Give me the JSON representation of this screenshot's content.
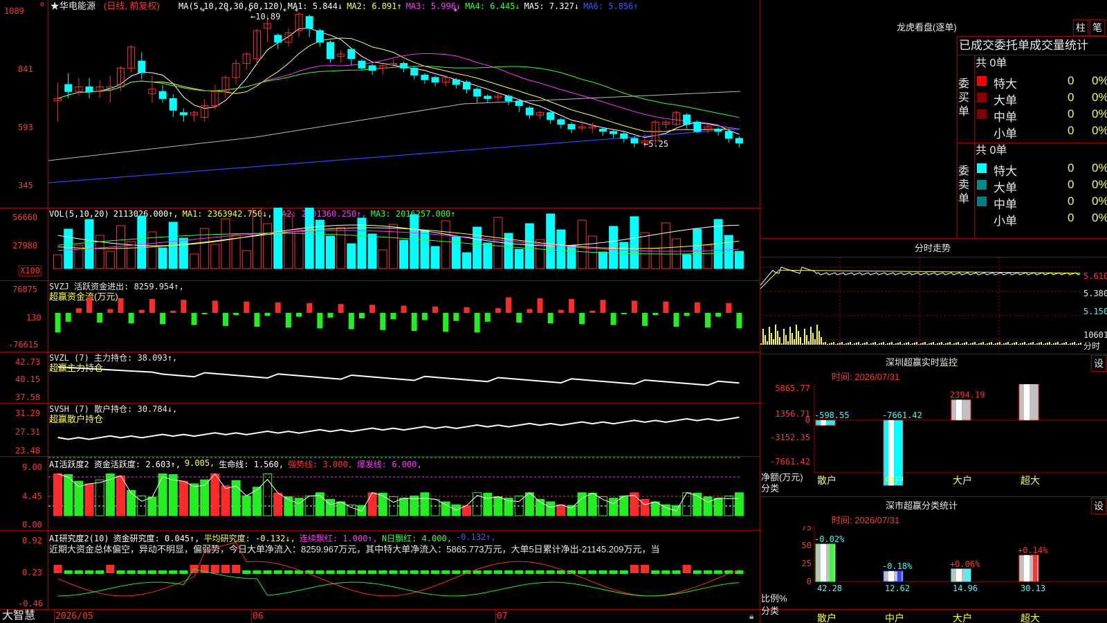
{
  "stock": {
    "name": "华电能源",
    "mode": "(日线, 前复权)",
    "star": "★"
  },
  "colors": {
    "up": "#ff2b2b",
    "down": "#00ffff",
    "ma1": "#ffffff",
    "ma2": "#ffff33",
    "ma3": "#ff33ff",
    "ma4": "#33ff33",
    "ma5": "#bbbbbb",
    "ma6": "#3344ff",
    "frame": "#a00000"
  },
  "price_panel": {
    "y_ticks": [
      "1089",
      "841",
      "593",
      "345"
    ],
    "header": [
      {
        "text": "MA(5,10,20,30,60,120)",
        "color": "#ffffff"
      },
      {
        "text": "MA1: 5.844↓",
        "color": "#ffffff"
      },
      {
        "text": "MA2: 6.091↑",
        "color": "#ffff33"
      },
      {
        "text": "MA3: 5.996↓",
        "color": "#ff33ff"
      },
      {
        "text": "MA4: 6.445↓",
        "color": "#33ff33"
      },
      {
        "text": "MA5: 7.327↓",
        "color": "#ffffff"
      },
      {
        "text": "MA6: 5.856↑",
        "color": "#3b5bff"
      }
    ],
    "high_label": "←10.89",
    "low_label": "←5.25"
  },
  "vol_panel": {
    "y_ticks": [
      "56660",
      "27980"
    ],
    "unit": "X100",
    "header": [
      {
        "text": "VOL(5,10,20)",
        "color": "#ffffff"
      },
      {
        "text": "2113026.000↑,",
        "color": "#ffffff"
      },
      {
        "text": "MA1: 2363942.750↓,",
        "color": "#ffff33"
      },
      {
        "text": "MA2: 2801360.250↑,",
        "color": "#ff33ff"
      },
      {
        "text": "MA3: 2016257.000↑",
        "color": "#33ff33"
      }
    ]
  },
  "svzj_panel": {
    "y_ticks": [
      "76875",
      "130",
      "-76615"
    ],
    "header": "SVZJ  活跃资金进出: 8259.954↑,",
    "sub": "超赢资金流(万元)"
  },
  "svzl_panel": {
    "y_ticks": [
      "42.73",
      "40.15",
      "37.58"
    ],
    "header": "SVZL (7) 主力持仓: 38.093↑,",
    "sub": "超赢主力持仓"
  },
  "svsh_panel": {
    "y_ticks": [
      "31.29",
      "27.31",
      "23.48"
    ],
    "header": "SVSH (7) 散户持仓: 30.784↓,",
    "sub": "超赢散户持仓"
  },
  "ai1_panel": {
    "y_ticks": [
      "9.00",
      "4.45",
      "0.00"
    ],
    "header": [
      {
        "text": "AI活跃度2 资金活跃度: 2.603↑,",
        "color": "#ffffff"
      },
      {
        "text": "9.005,",
        "color": "#ffff33"
      },
      {
        "text": "生命线: 1.560,",
        "color": "#ffffff"
      },
      {
        "text": "强势线: 3.000,",
        "color": "#ff3333"
      },
      {
        "text": "爆发线: 6.000,",
        "color": "#ff33ff"
      }
    ]
  },
  "ai2_panel": {
    "y_ticks": [
      "0.92",
      "0.23",
      "-0.46"
    ],
    "header": [
      {
        "text": "AI研究度2(10)",
        "color": "#ffffff"
      },
      {
        "text": "资金研究度: 0.045↑,",
        "color": "#ffffff"
      },
      {
        "text": "平均研究度: -0.132↓,",
        "color": "#ffff33"
      },
      {
        "text": "连续飘红: 1.000↑,",
        "color": "#ff33ff"
      },
      {
        "text": "N日飘红: 4.000,",
        "color": "#33ff33"
      },
      {
        "text": "-0.132↑,",
        "color": "#3b5bff"
      }
    ],
    "comment": "近期大资金总体偏空，异动不明显，偏弱势，今日大单净流入：8259.967万元，其中特大单净流入：5865.773万元，大单5日累计净出-21145.209万元，当"
  },
  "bottom_bar": {
    "brand": "大智慧",
    "dates": [
      "2026/05",
      "06",
      "07"
    ]
  },
  "right": {
    "dragon_title": "龙虎看盘(逐单)",
    "btn1": "柱",
    "btn2": "笔",
    "order_header": "已成交委托单成交量统计",
    "buy_side": {
      "label": "委买单",
      "total": "共 0单",
      "rows": [
        {
          "name": "特大",
          "count": "0",
          "pct": "0%",
          "color": "#ff0000"
        },
        {
          "name": "大单",
          "count": "0",
          "pct": "0%",
          "color": "#8b0000"
        },
        {
          "name": "中单",
          "count": "0",
          "pct": "0%",
          "color": "#800000"
        },
        {
          "name": "小单",
          "count": "0",
          "pct": "0%",
          "color": ""
        }
      ]
    },
    "sell_side": {
      "label": "委卖单",
      "total": "共 0单",
      "rows": [
        {
          "name": "特大",
          "count": "0",
          "pct": "0%",
          "color": "#00ffff"
        },
        {
          "name": "大单",
          "count": "0",
          "pct": "0%",
          "color": "#008b8b"
        },
        {
          "name": "中单",
          "count": "0",
          "pct": "0%",
          "color": "#008080"
        },
        {
          "name": "小单",
          "count": "0",
          "pct": "0%",
          "color": ""
        }
      ]
    },
    "intraday": {
      "title": "分时走势",
      "prices": [
        "5.610",
        "5.380",
        "5.150"
      ],
      "vol": "10601",
      "vol_unit": "分时"
    },
    "monitor": {
      "title": "深圳超赢实时监控",
      "btn": "设",
      "time": "时间: 2026/07/31",
      "y_ticks": [
        "5865.77",
        "1356.71",
        "0",
        "-3152.35",
        "-7661.42"
      ],
      "ylabel1": "净额(万元)",
      "ylabel2": "分类",
      "categories": [
        "散户",
        "中户",
        "大户",
        "超大"
      ],
      "values": [
        -598.55,
        -7661.42,
        2394.19,
        5865.77
      ],
      "labels": [
        "-598.55",
        "-7661.42",
        "2394.19",
        "5865.77"
      ]
    },
    "classify": {
      "title": "深市超赢分类统计",
      "btn": "设",
      "time": "时间: 2026/07/31",
      "y_ticks": [
        "75",
        "50",
        "25",
        "0"
      ],
      "ylabel1": "比例%",
      "ylabel2": "分类",
      "categories": [
        "散户",
        "中户",
        "大户",
        "超大"
      ],
      "values": [
        42.28,
        12.62,
        14.96,
        30.13
      ],
      "changes": [
        "-0.02%",
        "-0.18%",
        "+0.06%",
        "+0.14%"
      ],
      "value_labels": [
        "42.28",
        "12.62",
        "14.96",
        "30.13"
      ]
    }
  },
  "chart_data": {
    "type": "candlestick",
    "candles": [
      [
        700,
        770,
        710,
        620
      ],
      [
        770,
        810,
        740,
        720
      ],
      [
        740,
        790,
        760,
        730
      ],
      [
        760,
        790,
        740,
        720
      ],
      [
        740,
        780,
        760,
        720
      ],
      [
        760,
        800,
        760,
        700
      ],
      [
        760,
        820,
        840,
        750
      ],
      [
        840,
        920,
        930,
        830
      ],
      [
        870,
        900,
        820,
        800
      ],
      [
        730,
        800,
        750,
        700
      ],
      [
        740,
        760,
        710,
        700
      ],
      [
        710,
        720,
        660,
        640
      ],
      [
        650,
        660,
        640,
        620
      ],
      [
        640,
        650,
        650,
        620
      ],
      [
        630,
        700,
        680,
        620
      ],
      [
        680,
        760,
        740,
        670
      ],
      [
        740,
        800,
        800,
        720
      ],
      [
        800,
        870,
        860,
        780
      ],
      [
        860,
        900,
        900,
        840
      ],
      [
        880,
        950,
        1000,
        860
      ],
      [
        1010,
        1060,
        1030,
        960
      ],
      [
        980,
        980,
        950,
        930
      ],
      [
        950,
        1000,
        990,
        940
      ],
      [
        1000,
        1050,
        1070,
        980
      ],
      [
        1060,
        1020,
        1010,
        980
      ],
      [
        1000,
        970,
        950,
        940
      ],
      [
        950,
        900,
        880,
        870
      ],
      [
        890,
        910,
        900,
        870
      ],
      [
        920,
        890,
        880,
        860
      ],
      [
        870,
        850,
        840,
        840
      ],
      [
        850,
        840,
        830,
        820
      ],
      [
        840,
        850,
        850,
        820
      ],
      [
        860,
        870,
        860,
        850
      ],
      [
        860,
        860,
        840,
        830
      ],
      [
        840,
        820,
        810,
        800
      ],
      [
        810,
        800,
        790,
        780
      ],
      [
        800,
        790,
        780,
        770
      ],
      [
        780,
        800,
        800,
        770
      ],
      [
        790,
        780,
        770,
        760
      ],
      [
        780,
        760,
        750,
        740
      ],
      [
        750,
        720,
        720,
        700
      ],
      [
        720,
        720,
        710,
        700
      ],
      [
        720,
        730,
        720,
        700
      ],
      [
        720,
        700,
        700,
        690
      ],
      [
        700,
        680,
        680,
        660
      ],
      [
        670,
        650,
        640,
        630
      ],
      [
        640,
        650,
        650,
        630
      ],
      [
        650,
        640,
        620,
        610
      ],
      [
        620,
        600,
        600,
        590
      ],
      [
        600,
        580,
        580,
        570
      ],
      [
        590,
        610,
        590,
        580
      ],
      [
        590,
        600,
        590,
        570
      ],
      [
        580,
        580,
        570,
        560
      ],
      [
        570,
        560,
        560,
        550
      ],
      [
        560,
        540,
        540,
        530
      ],
      [
        540,
        520,
        520,
        510
      ],
      [
        520,
        550,
        530,
        510
      ],
      [
        530,
        600,
        610,
        520
      ],
      [
        600,
        600,
        610,
        590
      ],
      [
        600,
        640,
        650,
        600
      ],
      [
        640,
        620,
        600,
        590
      ],
      [
        610,
        580,
        570,
        570
      ],
      [
        580,
        590,
        590,
        570
      ],
      [
        580,
        570,
        570,
        560
      ],
      [
        570,
        540,
        540,
        530
      ],
      [
        540,
        520,
        520,
        510
      ]
    ]
  }
}
